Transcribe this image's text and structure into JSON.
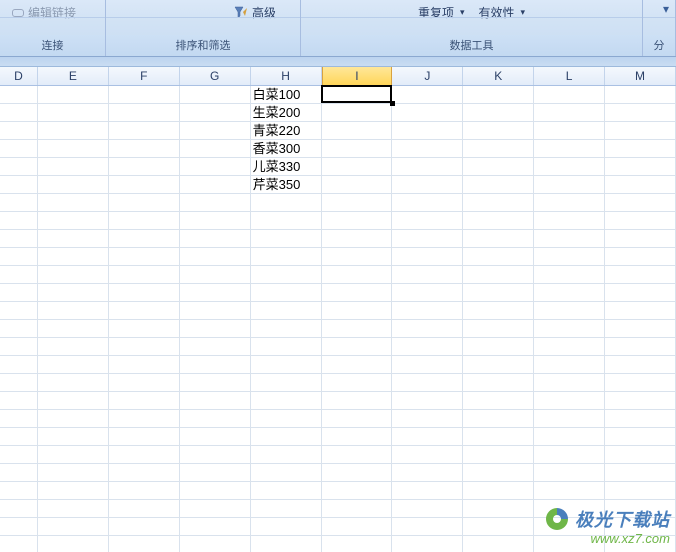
{
  "ribbon": {
    "groups": {
      "connections": {
        "edit_links": "编辑链接",
        "label": "连接"
      },
      "sort_filter": {
        "advanced": "高级",
        "label": "排序和筛选"
      },
      "data_tools": {
        "remove_duplicates": "重复项",
        "validation": "有效性",
        "label": "数据工具"
      },
      "outline": {
        "label": "分"
      }
    }
  },
  "columns": [
    "D",
    "E",
    "F",
    "G",
    "H",
    "I",
    "J",
    "K",
    "L",
    "M"
  ],
  "selected_column_index": 5,
  "rows": [
    {
      "H": "白菜100"
    },
    {
      "H": "生菜200"
    },
    {
      "H": "青菜220"
    },
    {
      "H": "香菜300"
    },
    {
      "H": "儿菜330"
    },
    {
      "H": "芹菜350"
    }
  ],
  "active_cell": {
    "row": 0,
    "col": "I"
  },
  "watermark": {
    "title": "极光下载站",
    "url": "www.xz7.com"
  }
}
